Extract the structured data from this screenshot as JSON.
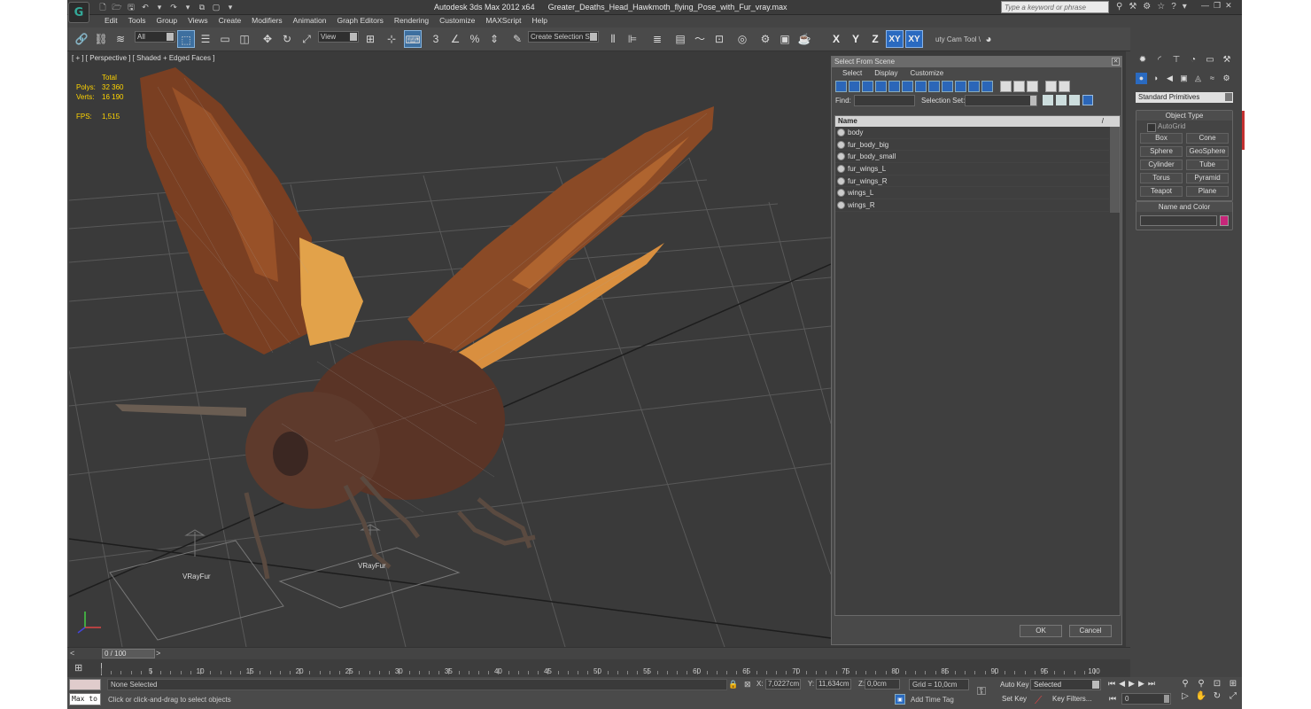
{
  "title": {
    "app_name": "Autodesk 3ds Max  2012 x64",
    "file_name": "Greater_Deaths_Head_Hawkmoth_flying_Pose_with_Fur_vray.max",
    "search_placeholder": "Type a keyword or phrase"
  },
  "menu": [
    "Edit",
    "Tools",
    "Group",
    "Views",
    "Create",
    "Modifiers",
    "Animation",
    "Graph Editors",
    "Rendering",
    "Customize",
    "MAXScript",
    "Help"
  ],
  "toolbar": {
    "filter_dropdown": "All",
    "ref_coord_dropdown": "View",
    "snap_label": "3",
    "percent_label": "%",
    "named_selection": "Create Selection Se",
    "axis_x": "X",
    "axis_y": "Y",
    "axis_z": "Z",
    "axis_xy": "XY",
    "axis_xy2": "XY",
    "cam_tool": "uty Cam Tool \\"
  },
  "viewport": {
    "label": "[ + ] [ Perspective ] [ Shaded + Edged Faces ]",
    "stats": {
      "total_label": "Total",
      "polys_label": "Polys:",
      "polys_value": "32 360",
      "verts_label": "Verts:",
      "verts_value": "16 190",
      "fps_label": "FPS:",
      "fps_value": "1,515"
    },
    "fur_label_1": "VRayFur",
    "fur_label_2": "VRayFur",
    "colors": {
      "background": "#3a3a3a",
      "stats_text": "#ffd400",
      "grid": "#555555"
    }
  },
  "select_from_scene": {
    "title": "Select From Scene",
    "menu": [
      "Select",
      "Display",
      "Customize"
    ],
    "find_label": "Find:",
    "selection_set_label": "Selection Set:",
    "column_name": "Name",
    "sort_indicator": "/",
    "objects": [
      "body",
      "fur_body_big",
      "fur_body_small",
      "fur_wings_L",
      "fur_wings_R",
      "wings_L",
      "wings_R"
    ],
    "ok_label": "OK",
    "cancel_label": "Cancel"
  },
  "command_panel": {
    "dropdown": "Standard Primitives",
    "object_type_label": "Object Type",
    "autogrid_label": "AutoGrid",
    "buttons": [
      "Box",
      "Cone",
      "Sphere",
      "GeoSphere",
      "Cylinder",
      "Tube",
      "Torus",
      "Pyramid",
      "Teapot",
      "Plane"
    ],
    "name_color_label": "Name and Color",
    "swatch_color": "#c8267a"
  },
  "timeline": {
    "frame_label": "0 / 100",
    "ticks": [
      5,
      10,
      15,
      20,
      25,
      30,
      35,
      40,
      45,
      50,
      55,
      60,
      65,
      70,
      75,
      80,
      85,
      90,
      95,
      100
    ]
  },
  "status": {
    "maxscript_label": "Max to",
    "selection": "None Selected",
    "prompt": "Click or click-and-drag to select objects",
    "x_label": "X:",
    "x_value": "7,0227cm",
    "y_label": "Y:",
    "y_value": "11,634cm",
    "z_label": "Z:",
    "z_value": "0,0cm",
    "grid": "Grid = 10,0cm",
    "add_time_tag": "Add Time Tag",
    "auto_key": "Auto Key",
    "set_key": "Set Key",
    "selected_dropdown": "Selected",
    "key_filters": "Key Filters...",
    "current_frame": "0"
  }
}
